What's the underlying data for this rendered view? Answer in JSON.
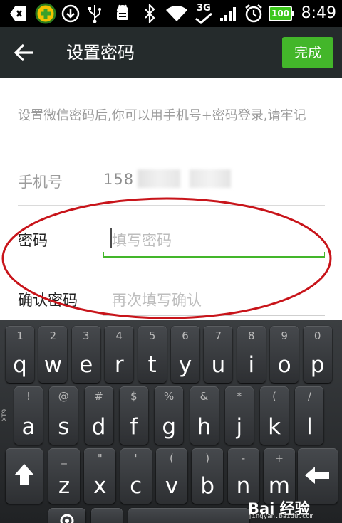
{
  "status_bar": {
    "time": "8:49",
    "network": "3G",
    "battery": "100",
    "icons": [
      "back-arrow-icon",
      "plus-badge-icon",
      "download-icon",
      "usb-icon",
      "android-debug-icon",
      "bluetooth-icon",
      "wifi-icon",
      "3g-signal-icon",
      "signal-bars-icon",
      "alarm-icon",
      "battery-icon"
    ]
  },
  "title_bar": {
    "title": "设置密码",
    "done_label": "完成",
    "accent": "#43b62a",
    "background": "#252b2c"
  },
  "form": {
    "hint": "设置微信密码后,你可以用手机号+密码登录,请牢记",
    "phone_label": "手机号",
    "phone_value": "158",
    "password_label": "密码",
    "password_placeholder": "填写密码",
    "confirm_label": "确认密码",
    "confirm_placeholder": "再次填写确认"
  },
  "keyboard": {
    "row1": [
      {
        "main": "q",
        "sub": "1"
      },
      {
        "main": "w",
        "sub": "2"
      },
      {
        "main": "e",
        "sub": "3"
      },
      {
        "main": "r",
        "sub": "4"
      },
      {
        "main": "t",
        "sub": "5"
      },
      {
        "main": "y",
        "sub": "6"
      },
      {
        "main": "u",
        "sub": "7"
      },
      {
        "main": "i",
        "sub": "8"
      },
      {
        "main": "o",
        "sub": "9"
      },
      {
        "main": "p",
        "sub": "0"
      }
    ],
    "row2": [
      {
        "main": "a",
        "sub": "!"
      },
      {
        "main": "s",
        "sub": "@"
      },
      {
        "main": "d",
        "sub": "#"
      },
      {
        "main": "f",
        "sub": "$"
      },
      {
        "main": "g",
        "sub": "%"
      },
      {
        "main": "h",
        "sub": "&"
      },
      {
        "main": "j",
        "sub": "*"
      },
      {
        "main": "k",
        "sub": "("
      },
      {
        "main": "l",
        "sub": "/"
      }
    ],
    "row3": [
      {
        "main": "z",
        "sub": "_"
      },
      {
        "main": "x",
        "sub": "\""
      },
      {
        "main": "c",
        "sub": "'"
      },
      {
        "main": "v",
        "sub": "("
      },
      {
        "main": "b",
        "sub": ")"
      },
      {
        "main": "n",
        "sub": "-"
      },
      {
        "main": "m",
        "sub": "+"
      }
    ],
    "side_label": "XT9",
    "shift_icon": "shift-arrow-icon",
    "backspace_icon": "backspace-icon",
    "settings_icon": "gear-icon"
  },
  "watermark": {
    "text": "Bai 经验",
    "sub": "jingyan.baidu.com"
  }
}
